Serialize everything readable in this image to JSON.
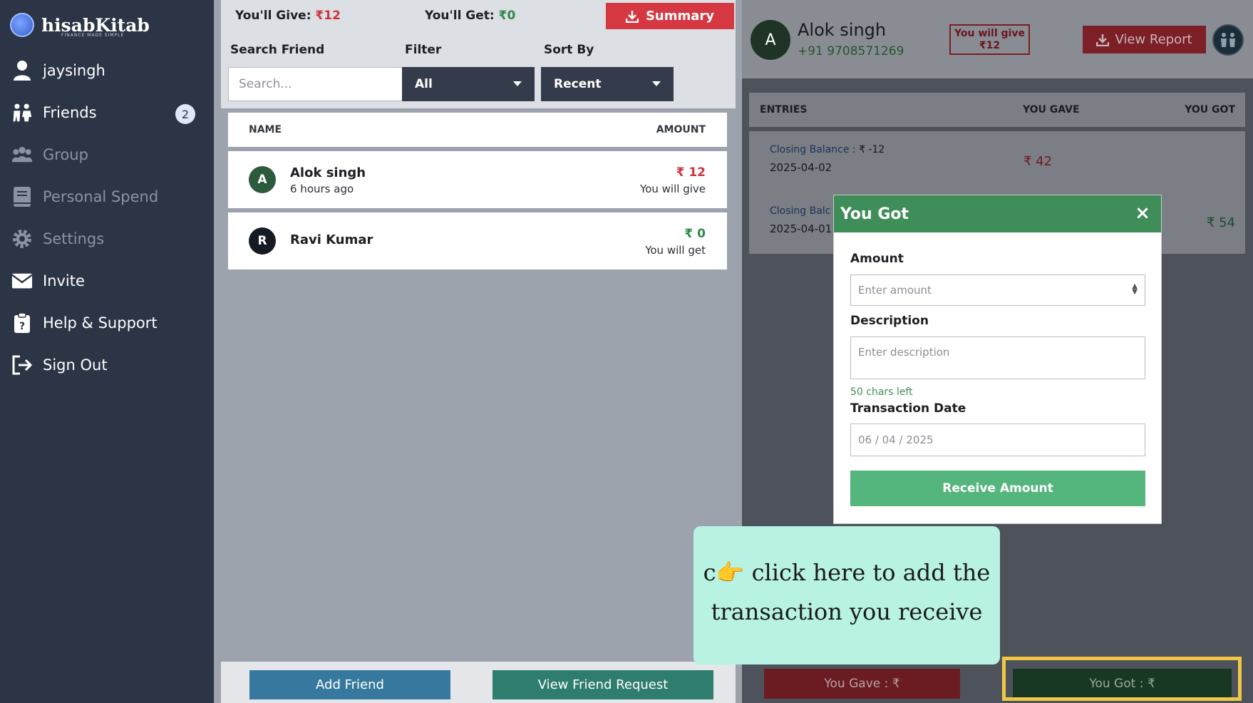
{
  "sidebar": {
    "brand": "hisabKitab",
    "brand_sub": "FINANCE MADE SIMPLE",
    "user": "jaysingh",
    "items": [
      {
        "label": "Friends",
        "badge": "2"
      },
      {
        "label": "Group"
      },
      {
        "label": "Personal Spend"
      },
      {
        "label": "Settings"
      },
      {
        "label": "Invite"
      },
      {
        "label": "Help & Support"
      },
      {
        "label": "Sign Out"
      }
    ]
  },
  "middle": {
    "give_label": "You'll Give:",
    "give_value": "₹12",
    "get_label": "You'll Get:",
    "get_value": "₹0",
    "summary_label": "Summary",
    "search_label": "Search Friend",
    "search_placeholder": "Search...",
    "filter_label": "Filter",
    "filter_value": "All",
    "sort_label": "Sort By",
    "sort_value": "Recent",
    "table": {
      "col_name": "NAME",
      "col_amount": "AMOUNT",
      "rows": [
        {
          "initial": "A",
          "name": "Alok singh",
          "time": "6 hours ago",
          "amount": "₹ 12",
          "hint": "You will give"
        },
        {
          "initial": "R",
          "name": "Ravi Kumar",
          "time": "",
          "amount": "₹ 0",
          "hint": "You will get"
        }
      ]
    },
    "add_friend": "Add Friend",
    "view_requests": "View Friend Request"
  },
  "right": {
    "initial": "A",
    "name": "Alok singh",
    "phone": "+91 9708571269",
    "will_give_line1": "You will give",
    "will_give_line2": "₹12",
    "view_report": "View Report",
    "entries_head": {
      "entries": "ENTRIES",
      "gave": "YOU GAVE",
      "got": "YOU GOT"
    },
    "entries": [
      {
        "label": "Closing Balance :",
        "value": "₹ -12",
        "date": "2025-04-02",
        "gave": "₹ 42",
        "got": ""
      },
      {
        "label": "Closing Balc",
        "value": "",
        "date": "2025-04-01",
        "gave": "",
        "got": "₹ 54"
      }
    ],
    "you_gave": "You Gave : ₹",
    "you_got": "You Got : ₹"
  },
  "modal": {
    "title": "You Got",
    "amount_label": "Amount",
    "amount_placeholder": "Enter amount",
    "desc_label": "Description",
    "desc_placeholder": "Enter description",
    "chars_left": "50 chars left",
    "date_label": "Transaction Date",
    "date_value": "06 / 04 / 2025",
    "submit": "Receive Amount"
  },
  "tooltip": {
    "line1": "c👉 click here to add the",
    "line2": "transaction you receive"
  },
  "colors": {
    "sidebar_bg": "#2c3545",
    "red": "#d0323c",
    "green": "#2f8a4a",
    "modal_header": "#3f8d58",
    "receive_button": "#55b67d",
    "highlight": "#f2c744",
    "tooltip_bg": "#b8f2e3"
  }
}
